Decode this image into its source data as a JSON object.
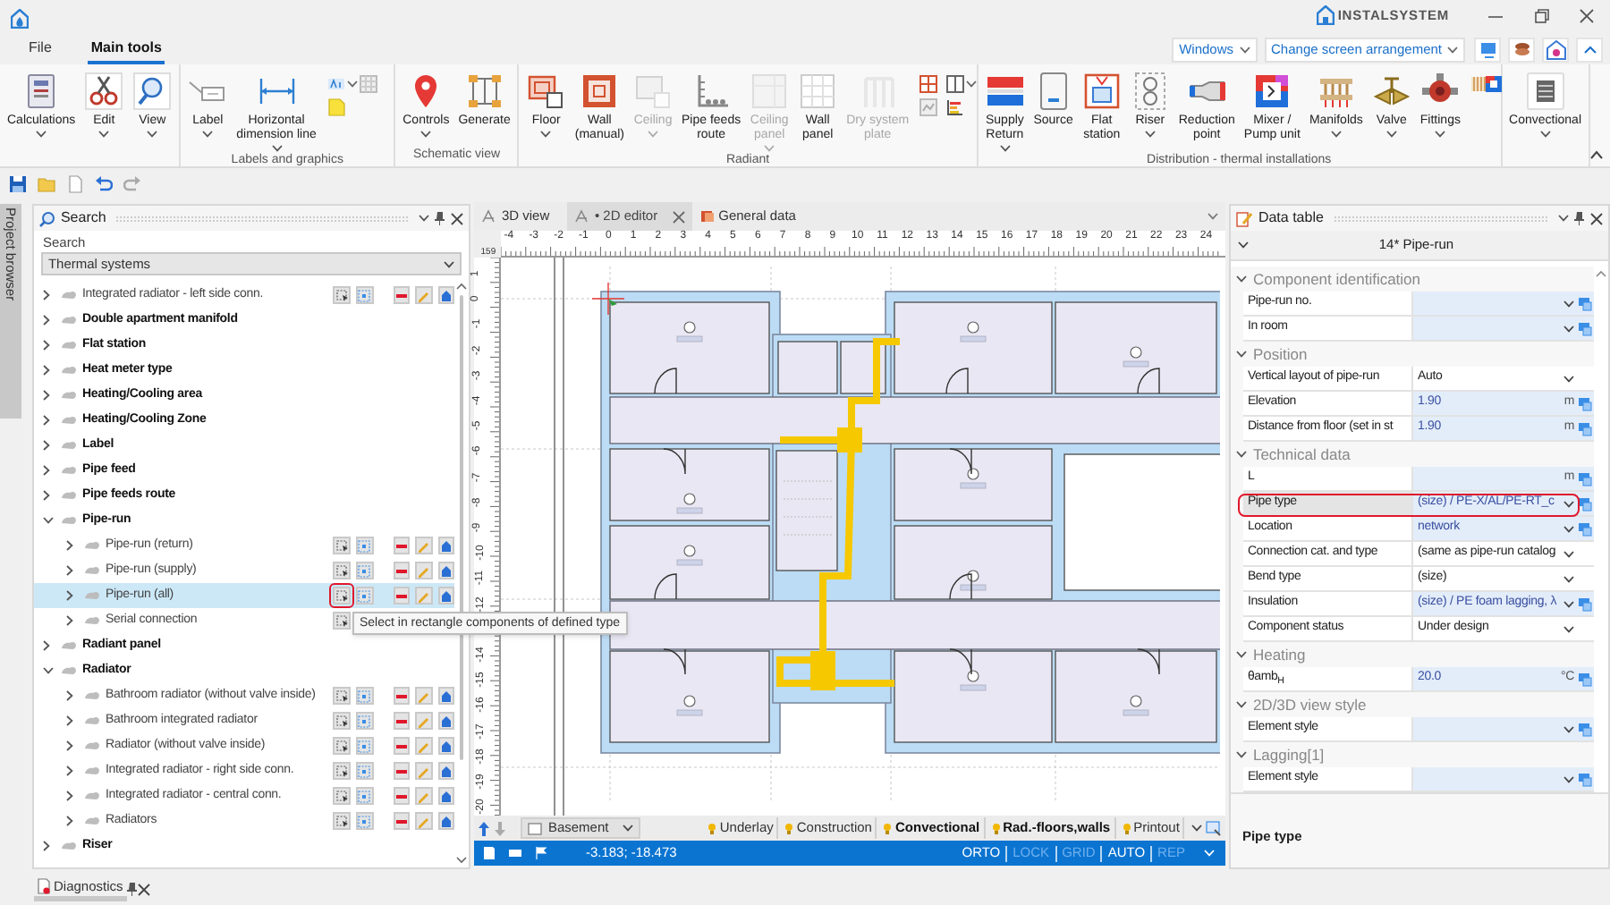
{
  "title_bar": {
    "logo": "INSTALSYSTEM"
  },
  "ribbon": {
    "tabs": [
      {
        "label": "File",
        "selected": false
      },
      {
        "label": "Main tools",
        "selected": true
      }
    ],
    "windows_menu": "Windows",
    "arrangement_menu": "Change screen arrangement",
    "groups": [
      {
        "buttons": [
          {
            "label": "Calculations",
            "dropdown": true,
            "disabled": false
          },
          {
            "label": "Edit",
            "dropdown": true,
            "disabled": false
          },
          {
            "label": "View",
            "dropdown": true,
            "disabled": false
          }
        ]
      },
      {
        "label": "Labels and graphics",
        "buttons": [
          {
            "label": "Label",
            "dropdown": true,
            "disabled": false
          },
          {
            "label": "Horizontal\ndimension line",
            "dropdown": true,
            "disabled": false
          }
        ]
      },
      {
        "label": "Schematic view",
        "buttons": [
          {
            "label": "Controls",
            "dropdown": true,
            "disabled": false
          },
          {
            "label": "Generate",
            "dropdown": false,
            "disabled": false
          }
        ]
      },
      {
        "label": "Radiant",
        "buttons": [
          {
            "label": "Floor",
            "dropdown": true,
            "disabled": false
          },
          {
            "label": "Wall\n(manual)",
            "dropdown": false,
            "disabled": false
          },
          {
            "label": "Ceiling",
            "dropdown": true,
            "disabled": true
          },
          {
            "label": "Pipe feeds\nroute",
            "dropdown": false,
            "disabled": false
          },
          {
            "label": "Ceiling\npanel",
            "dropdown": true,
            "disabled": true
          },
          {
            "label": "Wall\npanel",
            "dropdown": false,
            "disabled": false
          },
          {
            "label": "Dry system\nplate",
            "dropdown": false,
            "disabled": true
          }
        ]
      },
      {
        "label": "Distribution - thermal installations",
        "buttons": [
          {
            "label": "Supply\nReturn",
            "dropdown": true,
            "disabled": false
          },
          {
            "label": "Source",
            "dropdown": false,
            "disabled": false
          },
          {
            "label": "Flat\nstation",
            "dropdown": false,
            "disabled": false
          },
          {
            "label": "Riser",
            "dropdown": true,
            "disabled": false
          },
          {
            "label": "Reduction\npoint",
            "dropdown": false,
            "disabled": false
          },
          {
            "label": "Mixer /\nPump unit",
            "dropdown": false,
            "disabled": false
          },
          {
            "label": "Manifolds",
            "dropdown": true,
            "disabled": false
          },
          {
            "label": "Valve",
            "dropdown": true,
            "disabled": false
          },
          {
            "label": "Fittings",
            "dropdown": true,
            "disabled": false
          }
        ]
      },
      {
        "buttons": [
          {
            "label": "Convectional",
            "dropdown": true,
            "disabled": false
          }
        ]
      }
    ]
  },
  "project_browser": {
    "label": "Project browser"
  },
  "search_panel": {
    "title": "Search",
    "field_label": "Search",
    "filter": "Thermal systems",
    "items": [
      {
        "label": "Integrated radiator - left side conn.",
        "kind": "type",
        "expanded": false,
        "selected": false
      },
      {
        "label": "Double apartment manifold",
        "kind": "group",
        "expanded": false,
        "selected": false
      },
      {
        "label": "Flat station",
        "kind": "group",
        "expanded": false,
        "selected": false
      },
      {
        "label": "Heat meter type",
        "kind": "group",
        "expanded": false,
        "selected": false
      },
      {
        "label": "Heating/Cooling area",
        "kind": "group",
        "expanded": false,
        "selected": false
      },
      {
        "label": "Heating/Cooling Zone",
        "kind": "group",
        "expanded": false,
        "selected": false
      },
      {
        "label": "Label",
        "kind": "group",
        "expanded": false,
        "selected": false
      },
      {
        "label": "Pipe feed",
        "kind": "group",
        "expanded": false,
        "selected": false
      },
      {
        "label": "Pipe feeds route",
        "kind": "group",
        "expanded": false,
        "selected": false
      },
      {
        "label": "Pipe-run",
        "kind": "group",
        "expanded": true,
        "selected": false,
        "children": [
          {
            "label": "Pipe-run (return)",
            "kind": "type",
            "expanded": false,
            "selected": false
          },
          {
            "label": "Pipe-run (supply)",
            "kind": "type",
            "expanded": false,
            "selected": false
          },
          {
            "label": "Pipe-run (all)",
            "kind": "type",
            "expanded": false,
            "selected": true,
            "hovered": true
          },
          {
            "label": "Serial connection",
            "kind": "partial",
            "expanded": false,
            "selected": false
          }
        ]
      },
      {
        "label": "Radiant panel",
        "kind": "group",
        "expanded": false,
        "selected": false
      },
      {
        "label": "Radiator",
        "kind": "group",
        "expanded": true,
        "selected": false,
        "children": [
          {
            "label": "Bathroom radiator (without valve inside)",
            "kind": "type",
            "expanded": false,
            "selected": false
          },
          {
            "label": "Bathroom integrated radiator",
            "kind": "type",
            "expanded": false,
            "selected": false
          },
          {
            "label": "Radiator (without valve inside)",
            "kind": "type",
            "expanded": false,
            "selected": false
          },
          {
            "label": "Integrated radiator - right side conn.",
            "kind": "type",
            "expanded": false,
            "selected": false
          },
          {
            "label": "Integrated radiator - central conn.",
            "kind": "type",
            "expanded": false,
            "selected": false
          },
          {
            "label": "Radiators",
            "kind": "type",
            "expanded": false,
            "selected": false
          }
        ]
      },
      {
        "label": "Riser",
        "kind": "group",
        "expanded": false,
        "selected": false
      }
    ]
  },
  "tooltip": "Select in rectangle components of defined type",
  "editor": {
    "tabs": [
      {
        "label": "3D view",
        "selected": false,
        "closable": false
      },
      {
        "label": "• 2D editor",
        "selected": true,
        "closable": true
      },
      {
        "label": "General data",
        "selected": false,
        "closable": false
      }
    ],
    "ruler": {
      "corner": "159",
      "x_ticks": [
        "-4",
        "-3",
        "-2",
        "-1",
        "0",
        "1",
        "2",
        "3",
        "4",
        "5",
        "6",
        "7",
        "8",
        "9",
        "10",
        "11",
        "12",
        "13",
        "14",
        "15",
        "16",
        "17",
        "18",
        "19",
        "20",
        "21",
        "22",
        "23",
        "24"
      ],
      "y_ticks": [
        "1",
        "0",
        "-1",
        "-2",
        "-3",
        "-4",
        "-5",
        "-6",
        "-7",
        "-8",
        "-9",
        "-10",
        "-11",
        "-12"
      ],
      "y_ticks_lower": [
        "-14",
        "-15",
        "-16",
        "-17",
        "-18",
        "-19",
        "-20"
      ]
    },
    "floor": "Basement",
    "layers": [
      {
        "label": "Underlay",
        "active": false
      },
      {
        "label": "Construction",
        "active": false
      },
      {
        "label": "Convectional",
        "active": true
      },
      {
        "label": "Rad.-floors,walls",
        "active": true
      },
      {
        "label": "Printout",
        "active": false
      }
    ],
    "coordinates": "-3.183; -18.473",
    "modes": [
      {
        "label": "ORTO",
        "on": true
      },
      {
        "label": "LOCK",
        "on": false
      },
      {
        "label": "GRID",
        "on": false
      },
      {
        "label": "AUTO",
        "on": true
      },
      {
        "label": "REP",
        "on": false
      }
    ]
  },
  "data_table": {
    "title": "Data table",
    "component": "14* Pipe-run",
    "sections": [
      {
        "title": "Component identification",
        "expanded": true,
        "rows": [
          {
            "label": "Pipe-run no.",
            "dropdown": true,
            "linked": true,
            "selected": false
          },
          {
            "label": "In room",
            "dropdown": true,
            "linked": true,
            "selected": false
          }
        ]
      },
      {
        "title": "Position",
        "expanded": true,
        "rows": [
          {
            "label": "Vertical layout of pipe-run",
            "value": "Auto",
            "dropdown": true,
            "linked": false,
            "selected": false
          },
          {
            "label": "Elevation",
            "value": "1.90",
            "unit": "m",
            "dropdown": false,
            "linked": true,
            "selected": false
          },
          {
            "label": "Distance from floor (set in st",
            "value": "1.90",
            "unit": "m",
            "dropdown": false,
            "linked": true,
            "selected": false
          }
        ]
      },
      {
        "title": "Technical data",
        "expanded": true,
        "rows": [
          {
            "label": "L",
            "unit": "m",
            "dropdown": false,
            "linked": true,
            "selected": false
          },
          {
            "label": "Pipe type",
            "value": "(size) / PE-X/AL/PE-RT_c",
            "dropdown": true,
            "linked": true,
            "selected": true
          },
          {
            "label": "Location",
            "value": "network",
            "dropdown": true,
            "linked": true,
            "selected": false
          },
          {
            "label": "Connection cat. and type",
            "value": "(same as pipe-run catalog",
            "dropdown": true,
            "linked": false,
            "selected": false
          },
          {
            "label": "Bend type",
            "value": "(size)",
            "dropdown": true,
            "linked": false,
            "selected": false
          },
          {
            "label": "Insulation",
            "value": "(size) / PE foam lagging, λ",
            "dropdown": true,
            "linked": true,
            "selected": false
          },
          {
            "label": "Component status",
            "value": "Under design",
            "dropdown": true,
            "linked": false,
            "selected": false
          }
        ]
      },
      {
        "title": "Heating",
        "expanded": true,
        "rows": [
          {
            "label": "θamb$_{H}$",
            "value": "20.0",
            "unit": "°C",
            "dropdown": false,
            "linked": true,
            "selected": false
          }
        ]
      },
      {
        "title": "2D/3D view style",
        "expanded": true,
        "rows": [
          {
            "label": "Element style",
            "dropdown": true,
            "linked": true,
            "selected": false
          }
        ]
      },
      {
        "title": "Lagging[1]",
        "expanded": true,
        "rows": [
          {
            "label": "Element style",
            "dropdown": true,
            "linked": true,
            "selected": false
          }
        ]
      }
    ],
    "description": "Pipe type"
  },
  "diagnostics": {
    "title": "Diagnostics"
  }
}
